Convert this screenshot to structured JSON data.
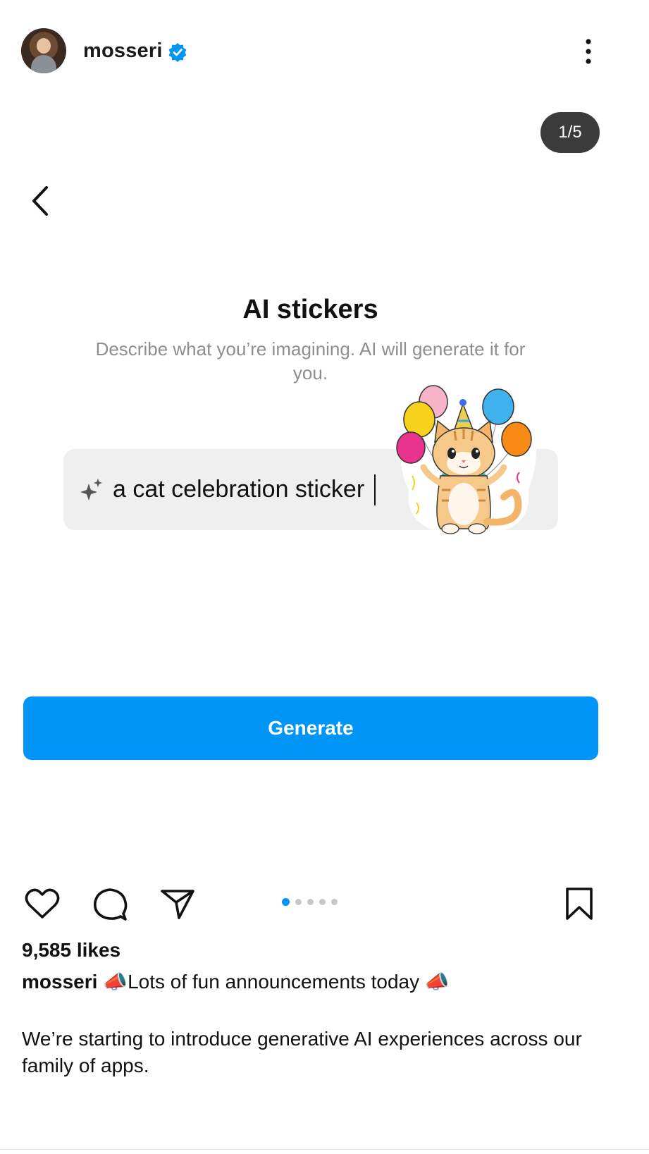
{
  "header": {
    "username": "mosseri",
    "verified_icon": "verified-badge-icon",
    "more_icon": "more-vertical-icon"
  },
  "carousel": {
    "counter": "1/5",
    "total_slides": 5,
    "active_slide": 1
  },
  "slide": {
    "back_icon": "chevron-left-icon",
    "title": "AI stickers",
    "subtitle": "Describe what you’re imagining. AI will generate it for you.",
    "input_icon": "sparkle-icon",
    "prompt_text": "a cat celebration sticker",
    "sticker": "cat-with-balloons-sticker",
    "generate_label": "Generate"
  },
  "actions": {
    "like_icon": "heart-icon",
    "comment_icon": "comment-icon",
    "share_icon": "send-icon",
    "save_icon": "bookmark-icon"
  },
  "post": {
    "likes": "9,585 likes",
    "caption_user": "mosseri",
    "caption_text": "Lots of fun announcements today",
    "body": "We’re starting to introduce generative AI experiences across our family of apps."
  },
  "colors": {
    "accent": "#0095f6",
    "pill": "#3b3b3b",
    "input_bg": "#efefef",
    "muted_text": "#8e8e8e"
  }
}
